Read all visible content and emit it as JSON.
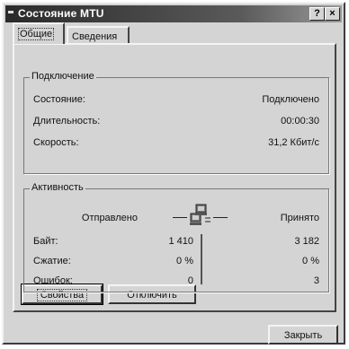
{
  "window": {
    "title": "Состояние MTU",
    "help_button": "?",
    "close_button": "×"
  },
  "tabs": [
    {
      "label": "Общие",
      "active": true
    },
    {
      "label": "Сведения",
      "active": false
    }
  ],
  "connection": {
    "legend": "Подключение",
    "rows": [
      {
        "label": "Состояние:",
        "value": "Подключено"
      },
      {
        "label": "Длительность:",
        "value": "00:00:30"
      },
      {
        "label": "Скорость:",
        "value": "31,2 Кбит/с"
      }
    ]
  },
  "activity": {
    "legend": "Активность",
    "sent_header": "Отправлено",
    "received_header": "Принято",
    "rows": [
      {
        "label": "Байт:",
        "sent": "1 410",
        "received": "3 182"
      },
      {
        "label": "Сжатие:",
        "sent": "0 %",
        "received": "0 %"
      },
      {
        "label": "Ошибок:",
        "sent": "0",
        "received": "3"
      }
    ]
  },
  "buttons": {
    "properties": "Свойства",
    "disconnect": "Отключить",
    "close": "Закрыть"
  },
  "icons": {
    "network": "network-computers-icon"
  }
}
